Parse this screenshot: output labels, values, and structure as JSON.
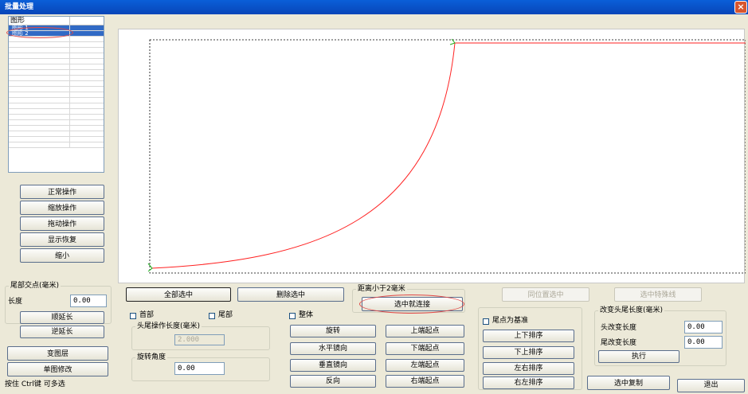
{
  "window": {
    "title": "批量处理",
    "close_glyph": "×"
  },
  "shape_list": {
    "header": "图形",
    "items": [
      "图形 1",
      "图形 2"
    ],
    "empty_rows": 20
  },
  "left_buttons": {
    "normal": "正常操作",
    "zoom": "缩放操作",
    "drag": "拖动操作",
    "restore": "显示恢复",
    "shrink": "缩小"
  },
  "tail_intersection": {
    "title": "尾部交点(毫米)",
    "length_label": "长度",
    "length_value": "0.00",
    "extend_cw": "顺延长",
    "extend_ccw": "逆延长"
  },
  "bottom_left": {
    "change_layer": "变图层",
    "single_edit": "单图修改",
    "hint": "按住 Ctrl键 可多选"
  },
  "select_all": "全部选中",
  "delete_selected": "删除选中",
  "distance_group": {
    "title": "距离小于2毫米",
    "connect": "选中就连接"
  },
  "options": {
    "head": "首部",
    "tail": "尾部",
    "whole": "整体"
  },
  "head_tail_group": {
    "title": "头尾操作长度(毫米)",
    "value": "2.000"
  },
  "rotate_group": {
    "title": "旋转角度",
    "value": "0.00"
  },
  "transform_buttons": {
    "rotate": "旋转",
    "hmirror": "水平镜向",
    "vmirror": "垂直镜向",
    "reverse": "反向",
    "top_start": "上端起点",
    "bottom_start": "下端起点",
    "left_start": "左端起点",
    "right_start": "右端起点"
  },
  "sort_group": {
    "tail_base": "尾点为基准",
    "sort_ud": "上下排序",
    "sort_du": "下上排序",
    "sort_lr": "左右排序",
    "sort_rl": "右左排序"
  },
  "same_pos_select": "同位置选中",
  "select_special": "选中特殊线",
  "change_head_tail": {
    "title": "改变头尾长度(毫米)",
    "head_label": "头改变长度",
    "head_value": "0.00",
    "tail_label": "尾改变长度",
    "tail_value": "0.00",
    "execute": "执行"
  },
  "copy_selected": "选中复制",
  "exit": "退出",
  "colors": {
    "curve": "#ff2020",
    "endpoint": "#20b020",
    "selection": "#316ac5",
    "title_bar": "#0a5fd8"
  }
}
